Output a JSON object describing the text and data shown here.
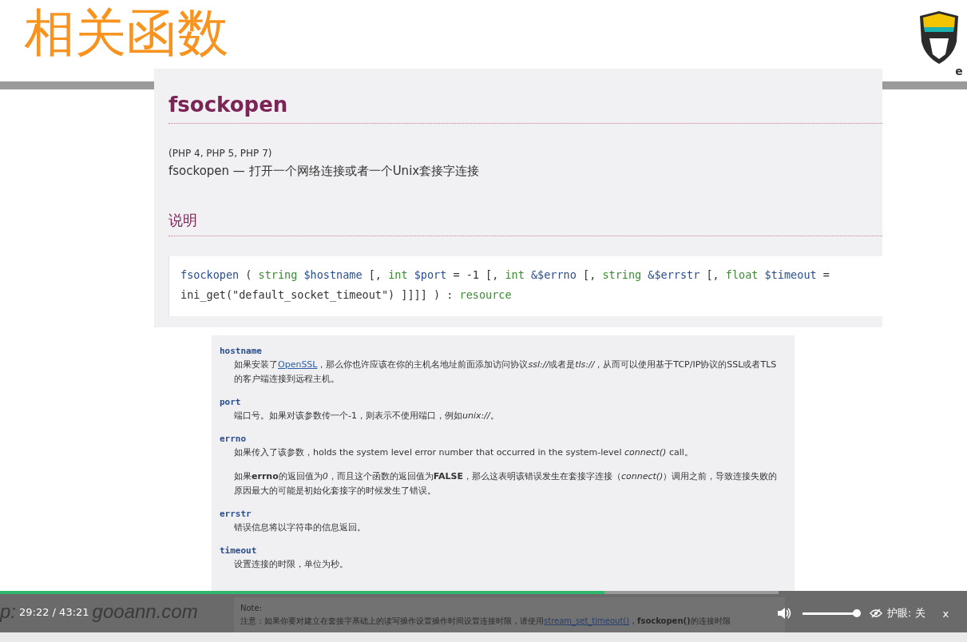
{
  "slide": {
    "title": "相关函数",
    "logo_text": "e",
    "footer": [
      "p:",
      "gooann.com"
    ]
  },
  "doc": {
    "function_name": "fsockopen",
    "versions": "(PHP 4, PHP 5, PHP 7)",
    "summary": "fsockopen — 打开一个网络连接或者一个Unix套接字连接",
    "section_title": "说明",
    "signature": [
      {
        "kind": "fn",
        "text": "fsockopen"
      },
      {
        "kind": "punct",
        "text": " ( "
      },
      {
        "kind": "type",
        "text": "string"
      },
      {
        "kind": "var",
        "text": " $hostname"
      },
      {
        "kind": "punct",
        "text": " [, "
      },
      {
        "kind": "type",
        "text": "int"
      },
      {
        "kind": "var",
        "text": " $port"
      },
      {
        "kind": "punct",
        "text": " = -1 [, "
      },
      {
        "kind": "type",
        "text": "int"
      },
      {
        "kind": "var",
        "text": " &$errno"
      },
      {
        "kind": "punct",
        "text": " [, "
      },
      {
        "kind": "type",
        "text": "string"
      },
      {
        "kind": "var",
        "text": " &$errstr"
      },
      {
        "kind": "punct",
        "text": " [, "
      },
      {
        "kind": "type",
        "text": "float"
      },
      {
        "kind": "var",
        "text": " $timeout"
      },
      {
        "kind": "punct",
        "text": " = ini_get(\"default_socket_timeout\") ]]]] ) : "
      },
      {
        "kind": "type",
        "text": "resource"
      }
    ]
  },
  "parameters": [
    {
      "name": "hostname",
      "paragraphs": [
        [
          {
            "kind": "text",
            "text": "如果安装了"
          },
          {
            "kind": "link",
            "text": "OpenSSL"
          },
          {
            "kind": "text",
            "text": "，那么你也许应该在你的主机名地址前面添加访问协议"
          },
          {
            "kind": "em",
            "text": "ssl://"
          },
          {
            "kind": "text",
            "text": "或者是"
          },
          {
            "kind": "em",
            "text": "tls://"
          },
          {
            "kind": "text",
            "text": "，从而可以使用基于TCP/IP协议的SSL或者TLS的客户端连接到远程主机。"
          }
        ]
      ]
    },
    {
      "name": "port",
      "paragraphs": [
        [
          {
            "kind": "text",
            "text": "端口号。如果对该参数传一个-1，则表示不使用端口，例如"
          },
          {
            "kind": "em",
            "text": "unix://"
          },
          {
            "kind": "text",
            "text": "。"
          }
        ]
      ]
    },
    {
      "name": "errno",
      "paragraphs": [
        [
          {
            "kind": "text",
            "text": "如果传入了该参数，holds the system level error number that occurred in the system-level *connect()* call。"
          }
        ],
        [
          {
            "kind": "text",
            "text": "如果**errno**的返回值为"
          },
          {
            "kind": "em",
            "text": "0"
          },
          {
            "kind": "text",
            "text": "，而且这个函数的返回值为**FALSE**，那么这表明该错误发生在套接字连接（*connect()*）调用之前，导致连接失败的原因最大的可能是初始化套接字的时候发生了错误。"
          }
        ]
      ]
    },
    {
      "name": "errstr",
      "paragraphs": [
        [
          {
            "kind": "text",
            "text": "错误信息将以字符串的信息返回。"
          }
        ]
      ]
    },
    {
      "name": "timeout",
      "paragraphs": [
        [
          {
            "kind": "text",
            "text": "设置连接的时限，单位为秒。"
          }
        ]
      ]
    }
  ],
  "note": {
    "title": "Note:",
    "parts": [
      {
        "kind": "text",
        "text": "注意：如果你要对建立在套接字基础上的读写操作设置操作时间设置连接时限，请使用"
      },
      {
        "kind": "link",
        "text": "stream_set_timeout()"
      },
      {
        "kind": "text",
        "text": "，**fsockopen()**的连接时限"
      }
    ]
  },
  "player": {
    "progress": {
      "level": 0.776
    },
    "time": "29:22 / 43:21",
    "volume": {
      "level": 0.95
    },
    "eye_care": "护眼: 关",
    "speed": "x"
  }
}
